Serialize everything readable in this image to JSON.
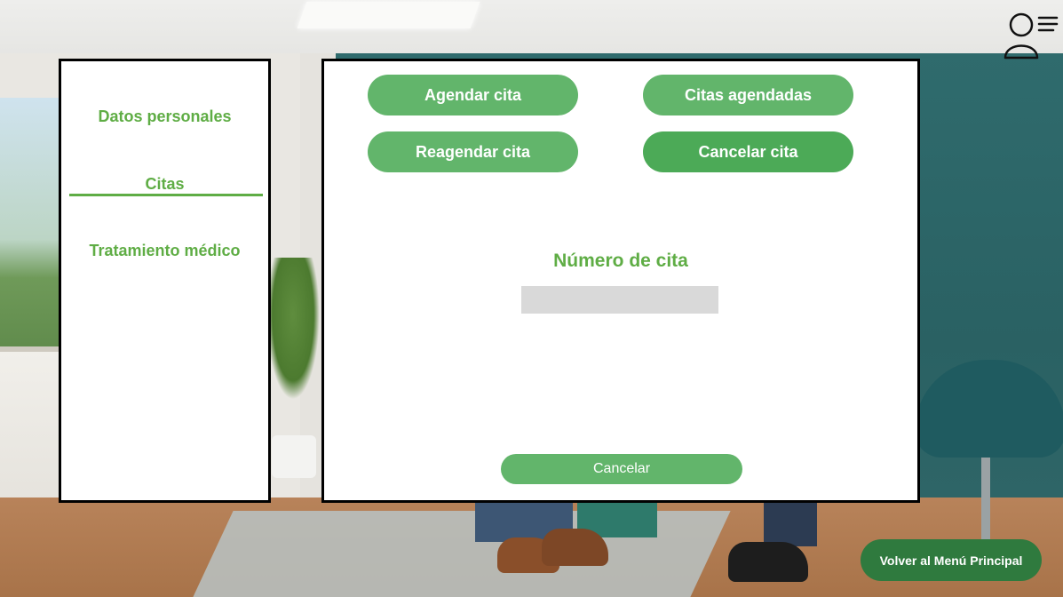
{
  "sidebar": {
    "items": [
      {
        "label": "Datos personales"
      },
      {
        "label": "Citas"
      },
      {
        "label": "Tratamiento médico"
      }
    ],
    "active": "Citas"
  },
  "actions": {
    "agendar": "Agendar cita",
    "agendadas": "Citas agendadas",
    "reagendar": "Reagendar cita",
    "cancelar": "Cancelar cita",
    "active": "Cancelar cita"
  },
  "form": {
    "label": "Número de cita",
    "value": "",
    "cancel_label": "Cancelar"
  },
  "footer": {
    "back_label": "Volver al Menú Principal"
  },
  "icons": {
    "user_menu": "user-menu-icon"
  },
  "colors": {
    "accent": "#5fad45",
    "button": "#62b56b",
    "button_dark": "#2f7a3e",
    "input_bg": "#d9d9d9"
  }
}
